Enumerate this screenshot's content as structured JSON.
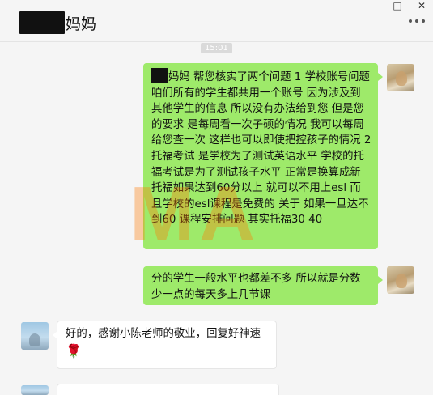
{
  "window": {
    "title": "妈妈",
    "minimize": "—",
    "maximize": "□",
    "close": "✕"
  },
  "chat": {
    "timestamp": "15:01",
    "messages": [
      {
        "sender": "me",
        "text": "妈妈 帮您核实了两个问题 1 学校账号问题 咱们所有的学生都共用一个账号 因为涉及到其他学生的信息 所以没有办法给到您 但是您的要求 是每周看一次子硕的情况 我可以每周给您查一次 这样也可以即使把控孩子的情况 2 托福考试 是学校为了测试英语水平 学校的托福考试是为了测试孩子水平 正常是换算成新托福如果达到60分以上 就可以不用上esl 而且学校的esl课程是免费的 关于 如果一旦达不到60 课程安排问题 其实托福30 40"
      },
      {
        "sender": "me",
        "text": "分的学生一般水平也都差不多 所以就是分数少一点的每天多上几节课"
      },
      {
        "sender": "other",
        "text": "好的，感谢小陈老师的敬业，回复好神速",
        "emoji": "🌹"
      }
    ]
  },
  "watermark": "MA",
  "icons": {
    "more": "more-icon",
    "rose": "rose-icon"
  }
}
